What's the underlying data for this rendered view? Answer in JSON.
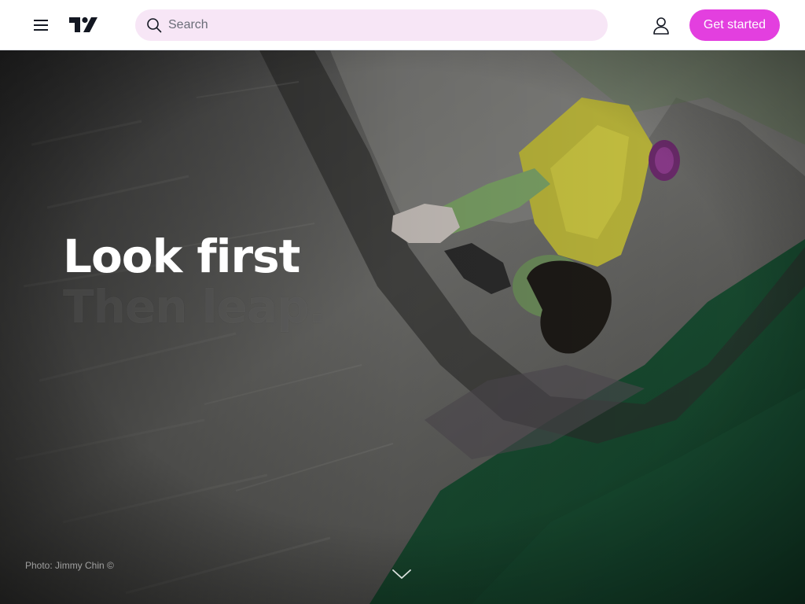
{
  "header": {
    "search_placeholder": "Search",
    "cta_label": "Get started"
  },
  "hero": {
    "headline_line1": "Look first",
    "headline_line2": "Then leap.",
    "photo_credit": "Photo: Jimmy Chin ©"
  },
  "colors": {
    "accent": "#e33fdf",
    "search_bg": "#f7e6f6",
    "header_bg": "#ffffff",
    "text_dark": "#131722"
  },
  "icons": {
    "menu": "hamburger-menu-icon",
    "logo": "tradingview-logo",
    "search": "search-icon",
    "user": "user-icon",
    "scroll": "chevron-down-icon"
  }
}
